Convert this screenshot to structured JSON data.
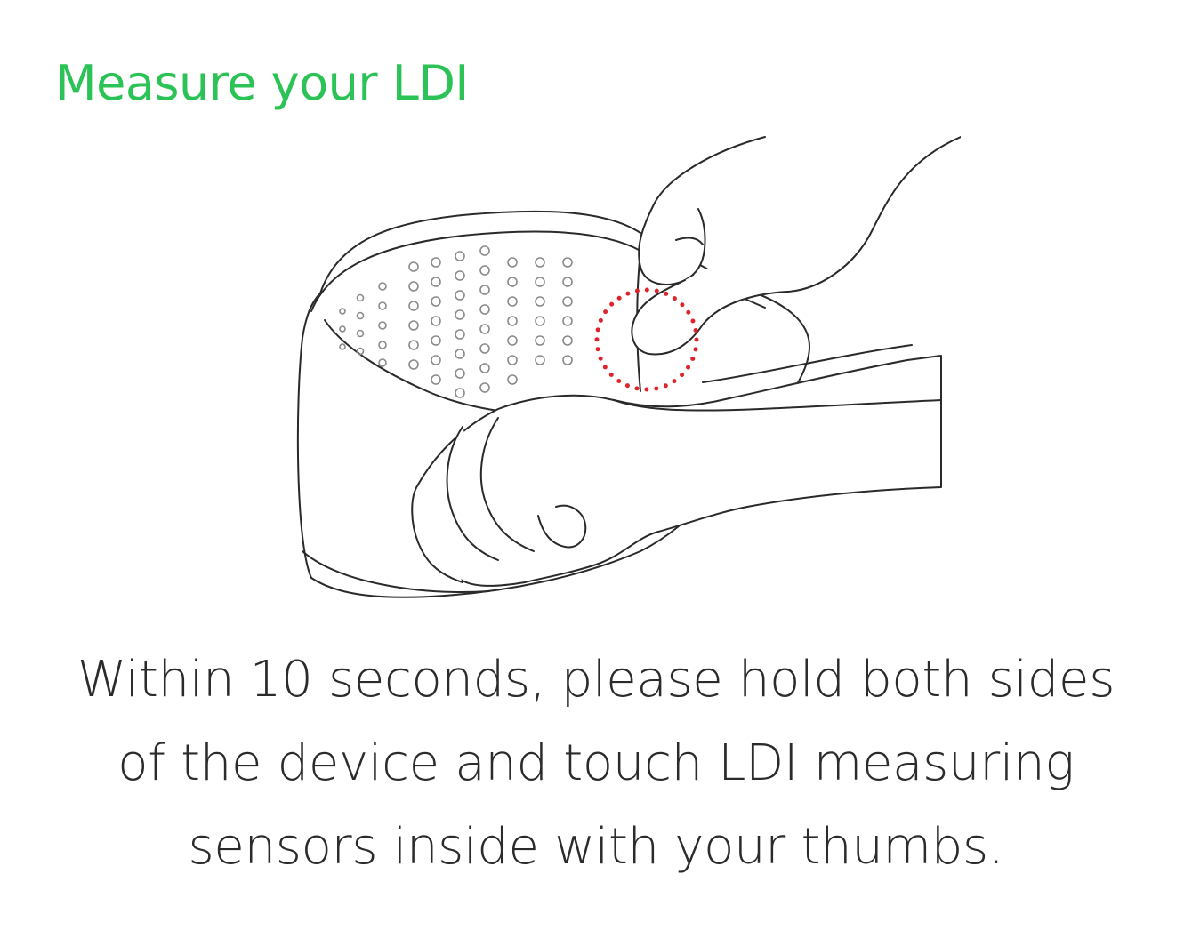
{
  "header": {
    "title": "Measure your LDI",
    "title_color": "#2bc256"
  },
  "illustration": {
    "icon": "device-hands-illustration",
    "highlight_icon": "sensor-highlight-dotted-circle",
    "highlight_color": "#e0232b"
  },
  "instruction": {
    "lines": [
      "Within 10 seconds, please hold both sides",
      "of the device and touch LDI measuring",
      "sensors inside with your thumbs."
    ]
  }
}
